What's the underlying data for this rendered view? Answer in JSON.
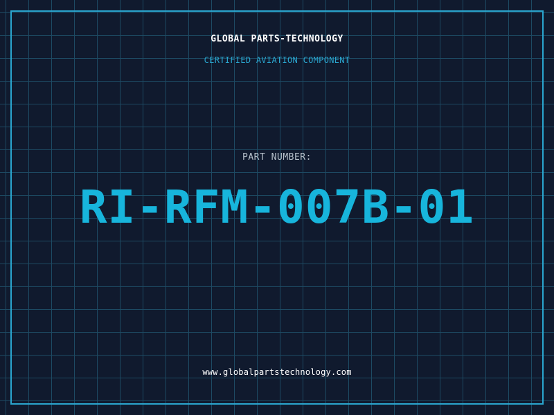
{
  "header": {
    "company_name": "GLOBAL PARTS-TECHNOLOGY",
    "subtitle": "CERTIFIED AVIATION COMPONENT"
  },
  "part": {
    "label": "PART NUMBER:",
    "number": "RI-RFM-007B-01"
  },
  "footer": {
    "website": "www.globalpartstechnology.com"
  },
  "colors": {
    "background": "#101a2e",
    "grid": "#1d4a63",
    "accent": "#17b5dc",
    "frame": "#2aa6cf",
    "text": "#ffffff",
    "muted": "#b8c2cc"
  }
}
